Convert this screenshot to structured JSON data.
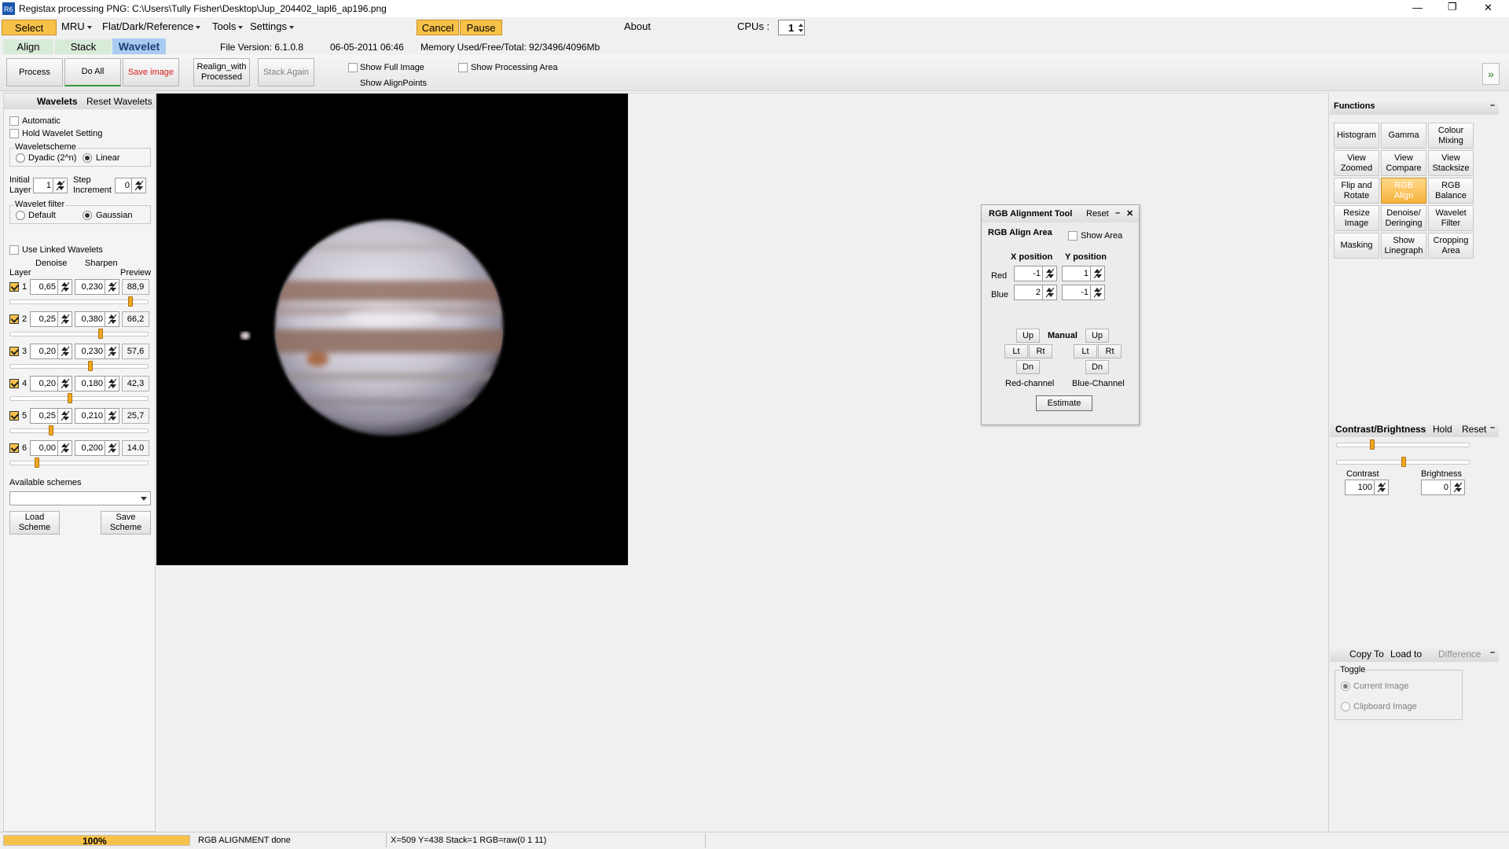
{
  "window": {
    "title": "Registax processing PNG: C:\\Users\\Tully Fisher\\Desktop\\Jup_204402_lapl6_ap196.png",
    "controls": {
      "minimize": "—",
      "restore": "❐",
      "close": "✕"
    }
  },
  "menubar": {
    "select": "Select",
    "mru": "MRU",
    "flat": "Flat/Dark/Reference",
    "tools": "Tools",
    "settings": "Settings",
    "cancel": "Cancel",
    "pause": "Pause",
    "about": "About",
    "cpus_label": "CPUs :",
    "cpus_value": "1"
  },
  "tabs": {
    "align": "Align",
    "stack": "Stack",
    "wavelet": "Wavelet",
    "file_version": "File Version: 6.1.0.8",
    "date": "06-05-2011 06:46",
    "memory": "Memory Used/Free/Total: 92/3496/4096Mb"
  },
  "toolbar": {
    "process": "Process",
    "do_all": "Do All",
    "save_image": "Save image",
    "realign": "Realign_with\nProcessed",
    "stack_again": "Stack Again",
    "show_full_image": "Show Full Image",
    "show_alignpoints": "Show AlignPoints",
    "show_processing_area": "Show Processing Area",
    "expand": "»"
  },
  "wavelets": {
    "title": "Wavelets",
    "reset": "Reset Wavelets",
    "automatic": "Automatic",
    "hold": "Hold Wavelet Setting",
    "scheme_group": "Waveletscheme",
    "dyadic": "Dyadic (2^n)",
    "linear": "Linear",
    "initial_layer_label": "Initial\nLayer",
    "initial_layer_value": "1",
    "step_label": "Step\nIncrement",
    "step_value": "0",
    "filter_group": "Wavelet filter",
    "default": "Default",
    "gaussian": "Gaussian",
    "use_linked": "Use Linked Wavelets",
    "col_layer": "Layer",
    "col_denoise": "Denoise",
    "col_sharpen": "Sharpen",
    "col_preview": "Preview",
    "layers": [
      {
        "num": "1",
        "denoise": "0,65",
        "sharpen": "0,230",
        "preview": "88,9",
        "level": 0.88
      },
      {
        "num": "2",
        "denoise": "0,25",
        "sharpen": "0,380",
        "preview": "66,2",
        "level": 0.66
      },
      {
        "num": "3",
        "denoise": "0,20",
        "sharpen": "0,230",
        "preview": "57,6",
        "level": 0.58
      },
      {
        "num": "4",
        "denoise": "0,20",
        "sharpen": "0,180",
        "preview": "42,3",
        "level": 0.43
      },
      {
        "num": "5",
        "denoise": "0,25",
        "sharpen": "0,210",
        "preview": "25,7",
        "level": 0.29
      },
      {
        "num": "6",
        "denoise": "0,00",
        "sharpen": "0,200",
        "preview": "14.0",
        "level": 0.18
      }
    ],
    "available_schemes": "Available schemes",
    "load_scheme": "Load\nScheme",
    "save_scheme": "Save\nScheme"
  },
  "rgb_tool": {
    "title": "RGB Alignment Tool",
    "reset": "Reset",
    "minimize": "–",
    "close": "✕",
    "align_area": "RGB Align Area",
    "show_area": "Show Area",
    "x_position": "X position",
    "y_position": "Y position",
    "red": "Red",
    "blue": "Blue",
    "red_x": "-1",
    "red_y": "1",
    "blue_x": "2",
    "blue_y": "-1",
    "manual": "Manual",
    "up": "Up",
    "lt": "Lt",
    "rt": "Rt",
    "dn": "Dn",
    "red_channel": "Red-channel",
    "blue_channel": "Blue-Channel",
    "estimate": "Estimate"
  },
  "functions": {
    "title": "Functions",
    "collapse": "–",
    "buttons": [
      "Histogram",
      "Gamma",
      "Colour\nMixing",
      "View\nZoomed",
      "View\nCompare",
      "View\nStacksize",
      "Flip and\nRotate",
      "RGB\nAlign",
      "RGB\nBalance",
      "Resize\nImage",
      "Denoise/\nDeringing",
      "Wavelet\nFilter",
      "Masking",
      "Show\nLinegraph",
      "Cropping\nArea"
    ],
    "selected": "RGB\nAlign"
  },
  "contrast": {
    "title": "Contrast/Brightness",
    "hold": "Hold",
    "reset": "Reset",
    "collapse": "–",
    "contrast_label": "Contrast",
    "contrast_value": "100",
    "brightness_label": "Brightness",
    "brightness_value": "0"
  },
  "copy": {
    "copy_to": "Copy To",
    "load_to": "Load to",
    "difference": "Difference",
    "collapse": "–",
    "toggle": "Toggle",
    "current_image": "Current Image",
    "clipboard_image": "Clipboard Image"
  },
  "status": {
    "progress": "100%",
    "progress_level": 1.0,
    "message": "RGB ALIGNMENT done",
    "info": "X=509 Y=438 Stack=1 RGB=raw(0 1 11)"
  },
  "colors": {
    "accent": "#f8c24a",
    "selected_tab": "#a9cbf2",
    "save_red": "#d42020"
  }
}
